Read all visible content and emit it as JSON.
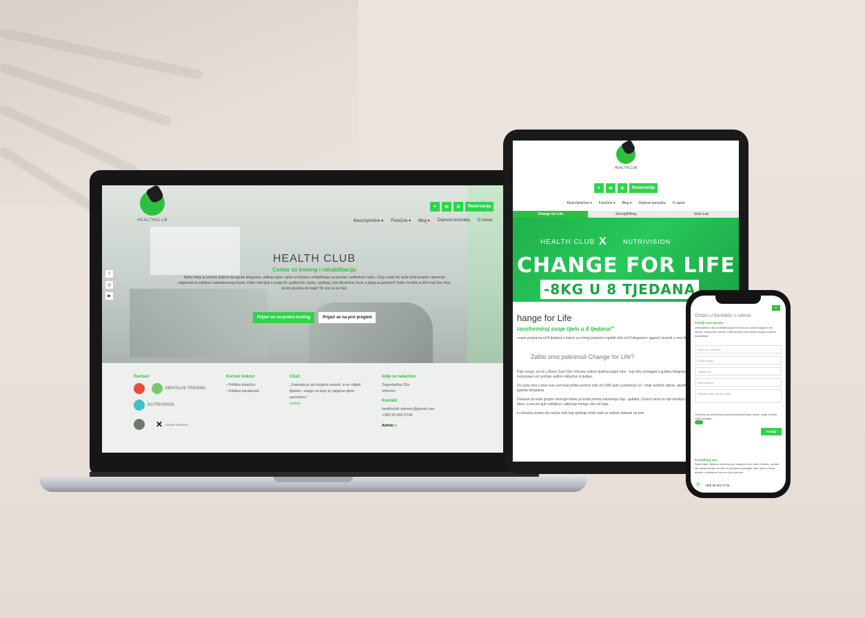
{
  "laptop": {
    "logo_text": "HEALTHCLUB",
    "action_icons": [
      "location-icon",
      "mail-icon",
      "phone-icon"
    ],
    "reservation_label": "Rezervacija",
    "nav": [
      "BasicGymOne ▾",
      "FizioOne ▾",
      "Blog ▾",
      "Dojmovi korisnika",
      "O nama"
    ],
    "social": [
      "f",
      "◎",
      "▶"
    ],
    "hero_title": "HEALTH CLUB",
    "hero_subtitle": "Centar za trening i rehabilitaciju",
    "hero_text": "Naša misija je pomoći ljudima da izgube kilograme, oblikuju tijelo, riješe se bolova i rehabilitiraju na pravilan i jedinstven način. Cilj je ostati što duže funkcionalan i spreman odgovoriti na zahtjeve svakodnevnog života. Zašto neki ljudi u svojoj 65. godini trče, skaču, vježbaju, žive dinamičan život, a drugi su pokretni? Zašto ne biste vi bili ti koji žive život punim plućima do kraja? Mi smo tu za Vas!",
    "cta_primary": "Prijavi se na probni trening",
    "cta_secondary": "Prijavi se na prvi pregled",
    "footer": {
      "partners_title": "Partneri",
      "partners": [
        "MENTALNI TRENING",
        "NUTRIVISION",
        "UNDER ARMOUR"
      ],
      "links_title": "Korisni linkovi",
      "links": [
        "› Politika kolačića",
        "› Politika privatnosti"
      ],
      "quote_title": "Citati",
      "quote": "„Sramota je za čovjeka ostariti, a ne vidjeti ljepotu i snagu za koju je njegovo tijelo sposobno.\"",
      "quote_author": "Sokrat",
      "location_title": "Gdje se nalazimo",
      "address_1": "Zagrebačka 25a",
      "address_2": "Vrbovec",
      "contact_title": "Kontakt",
      "email": "healthclub.vrbovec@gmail.com",
      "phone": "+385 95 952 0746",
      "admin": "Admin"
    }
  },
  "tablet": {
    "logo_text": "HEALTHCLUB",
    "reservation_label": "Rezervacija",
    "nav": [
      "BasicGymOne ▾",
      "FizioOne ▾",
      "Blog ▾",
      "Dojmovi korisnika",
      "O nama"
    ],
    "tabs": [
      "Change for Life",
      "Strongfitlifting",
      "Gluto Lab"
    ],
    "banner": {
      "brand": "HEALTH CLUB",
      "x": "X",
      "partner": "NUTRIVISION",
      "headline": "CHANGE FOR LIFE",
      "pill": "-8KG U 8 TJEDANA"
    },
    "article_title": "hange for Life",
    "article_sub": "ransformiroj svoje tijelo u 8 tjedana!\"",
    "article_text_1": "ruspio programa od 8 tjedana u kojem su mnogi polaznici izgubili više od 8 kilograma i aganul i krenuli u novi život.",
    "section_title": "Zašto smo pokrenuli Change for Life?",
    "article_text_2": "Prije svega, svi mi u Basic Gym One Vrbovec volimo ljudima pogot ruke - koji žele pomagati u gubitku kilograma. To je naša najveća snaga i svoj posao već počinje radimo isključivo iz ljubavi.",
    "article_text_3": "Do sada smo u bazi svoj vud imali priliku pomoći više od 1000 ljudi u protokolu 10 - imali različite ciljeve, ubedili smo da je većini najviši izazov gubitak kilograma.",
    "article_text_4": "Dolazak na naše grupne treninge dobar je korak prema ostvarenju cilja - gubitka. Znamo samo to nije dovoljno. Trening je samo 1 od 24 sata u danu, a proces gub zahtijeva i uključuje mnogo više od toga.",
    "article_text_5": "Iz iskustva znamo da većina onih koji vježbaju misle kako je redovit dolazak na tren"
  },
  "phone": {
    "menu_icon": "≡",
    "title": "Ostani u kontaktu s nama!",
    "form_title": "Pošalji nam poruku",
    "form_text": "Jednostavno nas kontaktiraj putem obrasca i izbaci odgovor već danas. Obavezno unesite email adresu kako bismo mogli povratno kontaktirati.",
    "fields": [
      "Vaše ime i prezime",
      "Email adresa",
      "Zanima me",
      "Broj mobitela",
      "Napišite Vašu poruku ovdje"
    ],
    "consent": "Označite da prihvaćate pravila privatnosti kako bismo mogli obraditi Vaše podatke.",
    "send": "Pošalji",
    "contact_title": "Kontaktiraj nas",
    "contact_text": "Radni dani i tijekom vikenda smo dostupni na e-mail i telefon; ukoliko ste zainteresirani za neki od programa pošaljite nam upit na email adresu, pričekamo Vas uz nove ponude.",
    "phone": "+385 95 952 0746"
  }
}
